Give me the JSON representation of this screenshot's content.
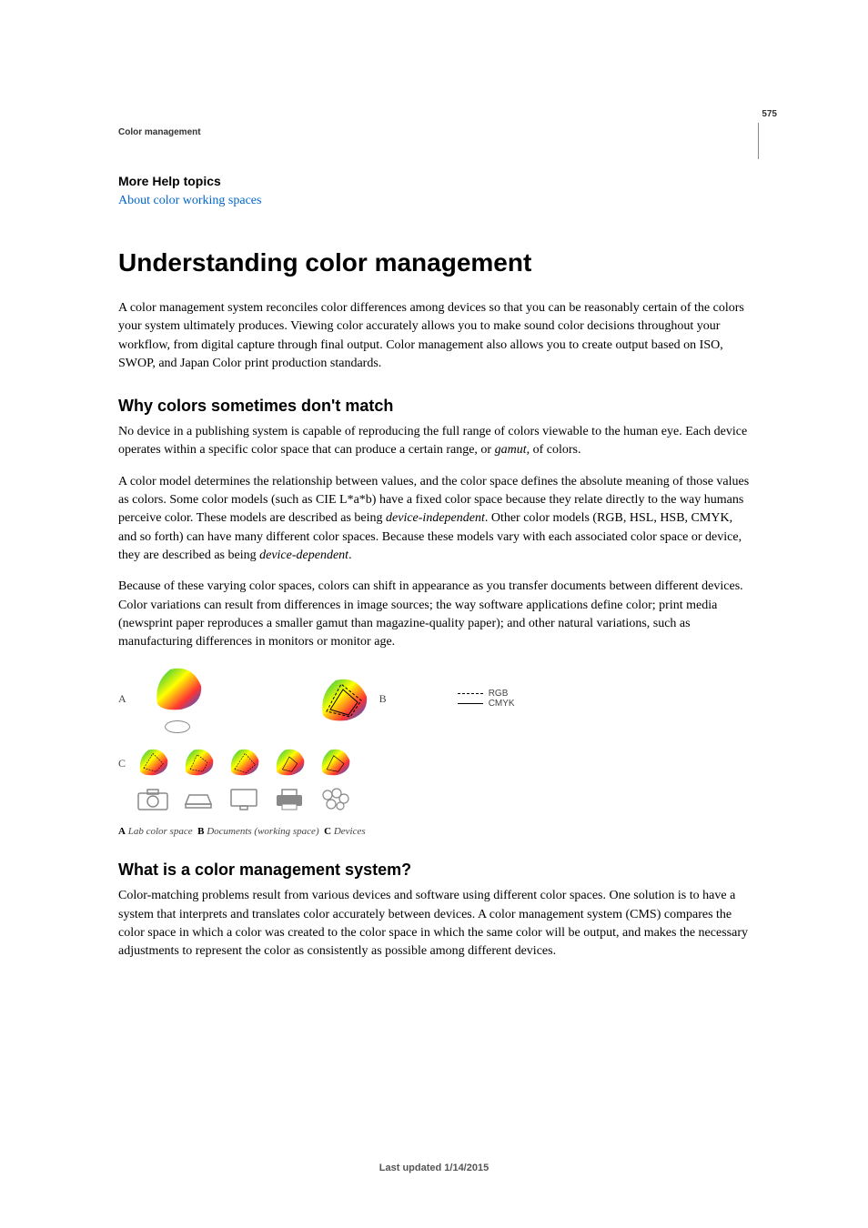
{
  "page_number": "575",
  "chapter_label": "Color management",
  "more_help": {
    "heading": "More Help topics",
    "link_text": "About color working spaces"
  },
  "article": {
    "title": "Understanding color management",
    "intro": "A color management system reconciles color differences among devices so that you can be reasonably certain of the colors your system ultimately produces. Viewing color accurately allows you to make sound color decisions throughout your workflow, from digital capture through final output. Color management also allows you to create output based on ISO, SWOP, and Japan Color print production standards."
  },
  "section1": {
    "heading": "Why colors sometimes don't match",
    "p1_a": "No device in a publishing system is capable of reproducing the full range of colors viewable to the human eye. Each device operates within a specific color space that can produce a certain range, or ",
    "p1_gamut": "gamut",
    "p1_b": ", of colors.",
    "p2_a": "A color model determines the relationship between values, and the color space defines the absolute meaning of those values as colors. Some color models (such as CIE L*a*b) have a fixed color space because they relate directly to the way humans perceive color. These models are described as being ",
    "p2_di": "device-independent",
    "p2_b": ". Other color models (RGB, HSL, HSB, CMYK, and so forth) can have many different color spaces. Because these models vary with each associated color space or device, they are described as being ",
    "p2_dd": "device-dependent",
    "p2_c": ".",
    "p3": "Because of these varying color spaces, colors can shift in appearance as you transfer documents between different devices. Color variations can result from differences in image sources; the way software applications define color; print media (newsprint paper reproduces a smaller gamut than magazine-quality paper); and other natural variations, such as manufacturing differences in monitors or monitor age."
  },
  "figure": {
    "label_a": "A",
    "label_b": "B",
    "label_c": "C",
    "legend_rgb": "RGB",
    "legend_cmyk": "CMYK",
    "caption_a_key": "A",
    "caption_a_text": "Lab color space",
    "caption_b_key": "B",
    "caption_b_text": "Documents (working space)",
    "caption_c_key": "C",
    "caption_c_text": "Devices"
  },
  "section2": {
    "heading": "What is a color management system?",
    "p1": "Color-matching problems result from various devices and software using different color spaces. One solution is to have a system that interprets and translates color accurately between devices. A color management system (CMS) compares the color space in which a color was created to the color space in which the same color will be output, and makes the necessary adjustments to represent the color as consistently as possible among different devices."
  },
  "footer": "Last updated 1/14/2015"
}
